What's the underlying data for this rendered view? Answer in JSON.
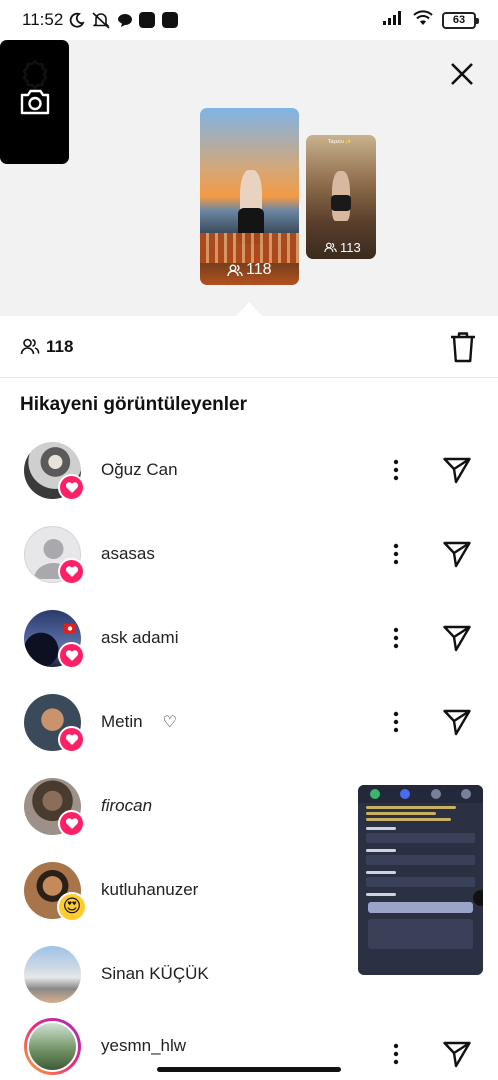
{
  "status_bar": {
    "time": "11:52",
    "battery": "63"
  },
  "story": {
    "main_count": "118",
    "second_count": "113",
    "second_caption": "Taşucu ✨"
  },
  "summary": {
    "viewer_count": "118"
  },
  "section_title": "Hikayeni görüntüleyenler",
  "viewers": [
    {
      "name": "Oğuz Can",
      "badge": "heart"
    },
    {
      "name": "asasas",
      "badge": "heart"
    },
    {
      "name": "ask adami",
      "badge": "heart"
    },
    {
      "name": "Metin",
      "suffix": "♡",
      "badge": "heart"
    },
    {
      "name": "firocan",
      "badge": "heart"
    },
    {
      "name": "kutluhanuzer",
      "badge": "😍"
    },
    {
      "name": "Sinan KÜÇÜK",
      "badge": "none"
    },
    {
      "name": "yesmn_hlw",
      "badge": "none"
    }
  ],
  "colors": {
    "reaction_pink": "#ff1f67",
    "story_bg": "#f2f2f2"
  }
}
